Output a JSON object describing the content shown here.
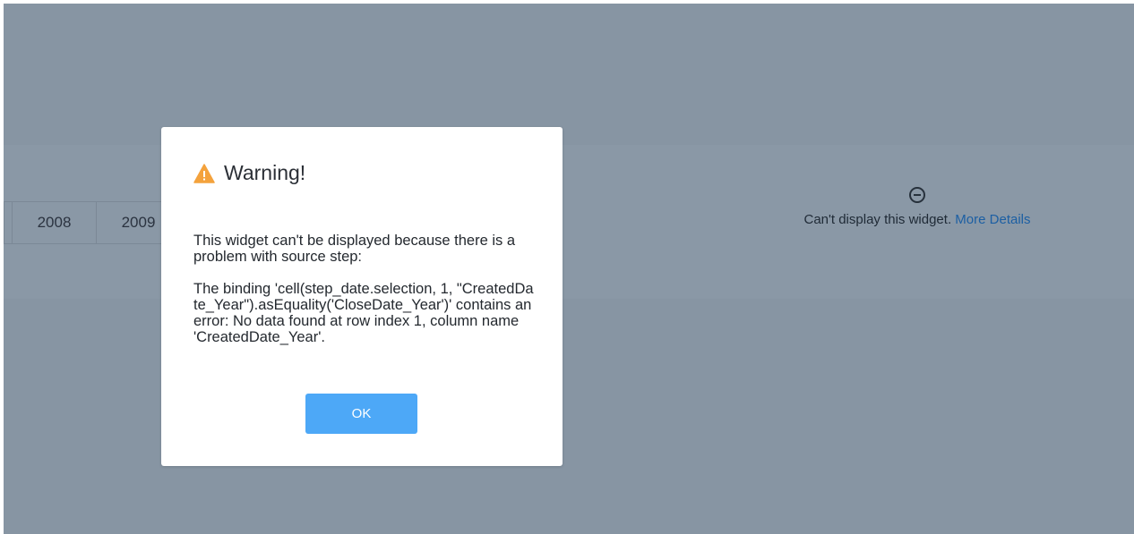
{
  "background": {
    "years": [
      "",
      "2008",
      "2009"
    ]
  },
  "widget_error": {
    "message": "Can't display this widget.",
    "link": "More Details"
  },
  "dialog": {
    "title": "Warning!",
    "paragraph_1": "This widget can't be displayed because there is a problem with source step:",
    "paragraph_2": "The binding 'cell(step_date.selection, 1, \"CreatedDate_Year\").asEquality('CloseDate_Year')' contains an error: No data found at row index 1, column name 'CreatedDate_Year'.",
    "ok_label": "OK"
  },
  "colors": {
    "overlay": "#8795a3",
    "accent_button": "#4da8f7",
    "warning_icon": "#f4a23c",
    "link": "#1c5fa3"
  }
}
